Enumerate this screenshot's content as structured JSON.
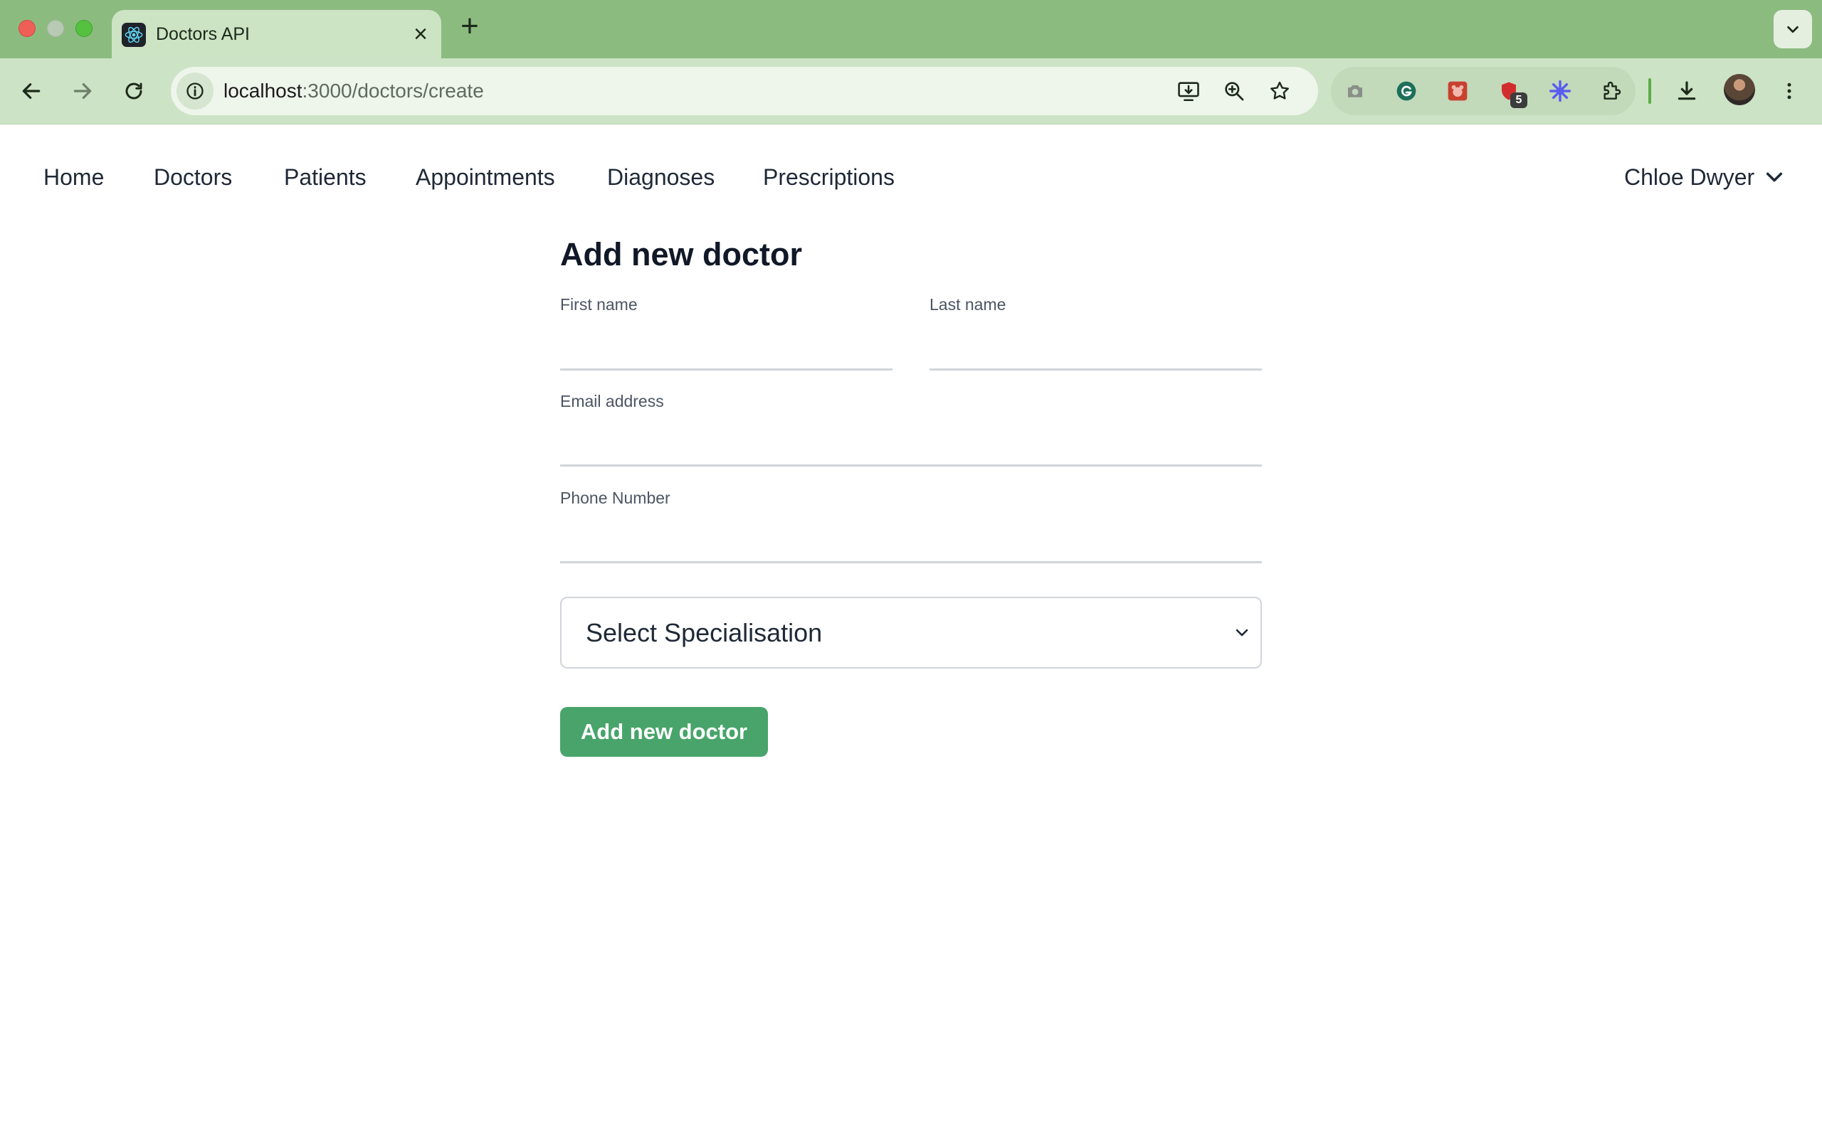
{
  "browser": {
    "tab_title": "Doctors API",
    "new_tab_symbol": "+",
    "close_symbol": "×",
    "url_host": "localhost",
    "url_path": ":3000/doctors/create",
    "extension_badge_count": "5",
    "colors": {
      "frame": "#8cbb80",
      "toolbar": "#cde3c5"
    }
  },
  "nav": {
    "links": [
      "Home",
      "Doctors",
      "Patients",
      "Appointments",
      "Diagnoses",
      "Prescriptions"
    ],
    "user_name": "Chloe Dwyer"
  },
  "form": {
    "title": "Add new doctor",
    "first_name": {
      "label": "First name",
      "value": ""
    },
    "last_name": {
      "label": "Last name",
      "value": ""
    },
    "email": {
      "label": "Email address",
      "value": ""
    },
    "phone": {
      "label": "Phone Number",
      "value": ""
    },
    "specialisation": {
      "selected": "Select Specialisation"
    },
    "submit_label": "Add new doctor",
    "colors": {
      "button": "#48a46a",
      "underline": "#d1d5db"
    }
  }
}
